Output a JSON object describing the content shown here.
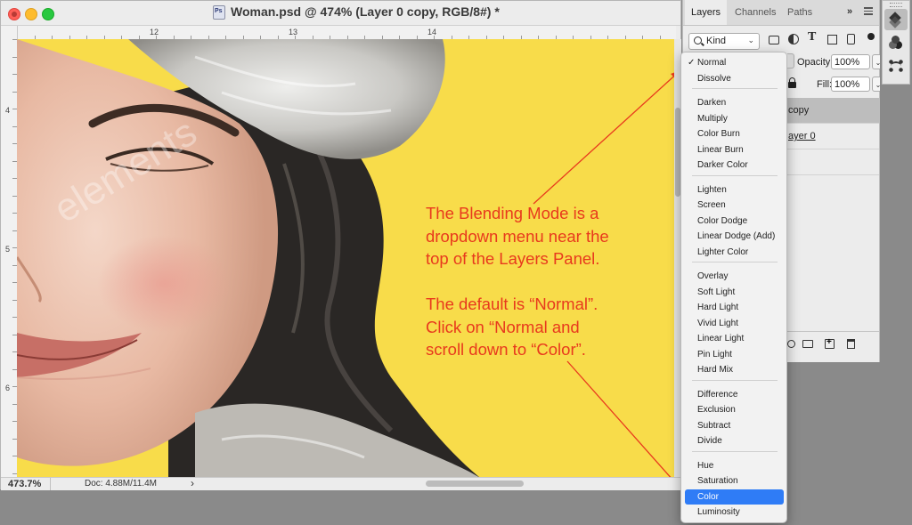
{
  "document": {
    "title": "Woman.psd @ 474% (Layer 0 copy, RGB/8#) *",
    "ruler_h_labels": [
      "12",
      "13",
      "14"
    ],
    "ruler_v_labels": [
      "4",
      "5",
      "6"
    ],
    "zoom": "473.7%",
    "doc_info": "Doc: 4.88M/11.4M",
    "status_arrow": "›"
  },
  "layers_panel": {
    "tabs": [
      "Layers",
      "Channels",
      "Paths"
    ],
    "tab_overflow": "»",
    "filter_kind": "Kind",
    "filter_text_icon": "T",
    "opacity_label": "Opacity:",
    "opacity_value": "100%",
    "fill_label": "Fill:",
    "fill_value": "100%",
    "layers": [
      {
        "name": "copy",
        "selected": true
      },
      {
        "name": "ayer 0",
        "selected": false
      }
    ]
  },
  "blend_menu": {
    "check_mark": "✓",
    "groups": [
      [
        "Normal",
        "Dissolve"
      ],
      [
        "Darken",
        "Multiply",
        "Color Burn",
        "Linear Burn",
        "Darker Color"
      ],
      [
        "Lighten",
        "Screen",
        "Color Dodge",
        "Linear Dodge (Add)",
        "Lighter Color"
      ],
      [
        "Overlay",
        "Soft Light",
        "Hard Light",
        "Vivid Light",
        "Linear Light",
        "Pin Light",
        "Hard Mix"
      ],
      [
        "Difference",
        "Exclusion",
        "Subtract",
        "Divide"
      ],
      [
        "Hue",
        "Saturation",
        "Color",
        "Luminosity"
      ]
    ],
    "checked": "Normal",
    "highlighted": "Color"
  },
  "annotation": {
    "text": "The Blending Mode is a\ndropdown menu near the\ntop of the Layers Panel.\n\nThe default is “Normal”.\nClick on “Normal and\nscroll down to “Color”."
  },
  "watermark": "elements",
  "colors": {
    "annotation": "#e8391d",
    "highlight": "#2f7cf6",
    "canvas_background": "#f8dc4a"
  },
  "icons": [
    "psd-file-icon",
    "search-icon",
    "image-filter-icon",
    "adjustment-filter-icon",
    "type-filter-icon",
    "shape-filter-icon",
    "smart-object-filter-icon",
    "filter-toggle-icon",
    "lock-icon",
    "fx-icon",
    "folder-icon",
    "new-layer-icon",
    "trash-icon",
    "layers-icon",
    "channels-icon",
    "paths-icon",
    "panel-menu-icon"
  ]
}
